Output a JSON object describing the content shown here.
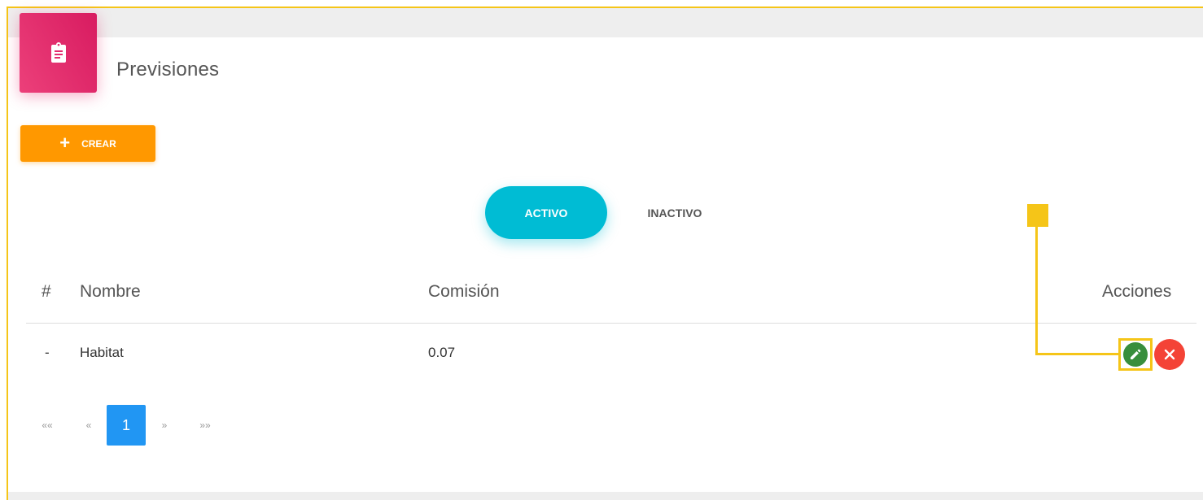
{
  "page": {
    "title": "Previsiones",
    "icon": "clipboard-icon",
    "accent_color": "#e91e63"
  },
  "toolbar": {
    "create_icon": "plus-icon",
    "create_label": "CREAR",
    "create_color": "#ff9800"
  },
  "tabs": [
    {
      "label": "ACTIVO",
      "selected": true,
      "color": "#00bcd4"
    },
    {
      "label": "INACTIVO",
      "selected": false
    }
  ],
  "table": {
    "headers": [
      "#",
      "Nombre",
      "Comisión",
      "Acciones"
    ],
    "rows": [
      {
        "index": "-",
        "nombre": "Habitat",
        "comision": "0.07",
        "actions": [
          {
            "icon": "pencil-icon",
            "color": "#388e3c",
            "highlighted": true
          },
          {
            "icon": "close-icon",
            "color": "#f44336"
          }
        ]
      }
    ]
  },
  "pagination": {
    "first": "««",
    "prev": "«",
    "pages": [
      "1"
    ],
    "current": "1",
    "next": "»",
    "last": "»»",
    "active_color": "#2196f3"
  },
  "annotation": {
    "color": "#f5c518"
  }
}
